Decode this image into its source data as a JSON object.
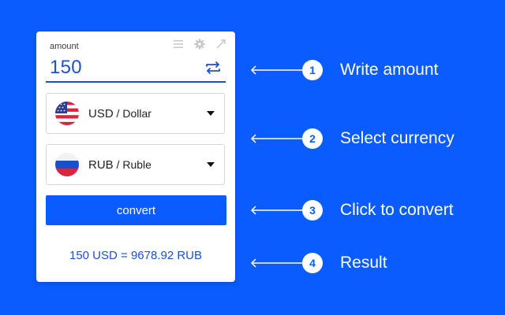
{
  "colors": {
    "background": "#0a5cff",
    "accent": "#1a4fd6",
    "card": "#ffffff"
  },
  "widget": {
    "toolbar_icons": [
      "menu-icon",
      "gear-icon",
      "expand-icon"
    ],
    "amount": {
      "label": "amount",
      "value": "150"
    },
    "from_currency": {
      "code": "USD",
      "separator": " / ",
      "name": "Dollar",
      "flag": "us-flag-icon"
    },
    "to_currency": {
      "code": "RUB",
      "separator": " / ",
      "name": "Ruble",
      "flag": "ru-flag-icon"
    },
    "convert_label": "convert",
    "result": "150 USD = 9678.92 RUB"
  },
  "callouts": [
    {
      "number": "1",
      "text": "Write amount"
    },
    {
      "number": "2",
      "text": "Select currency"
    },
    {
      "number": "3",
      "text": "Click to convert"
    },
    {
      "number": "4",
      "text": "Result"
    }
  ]
}
